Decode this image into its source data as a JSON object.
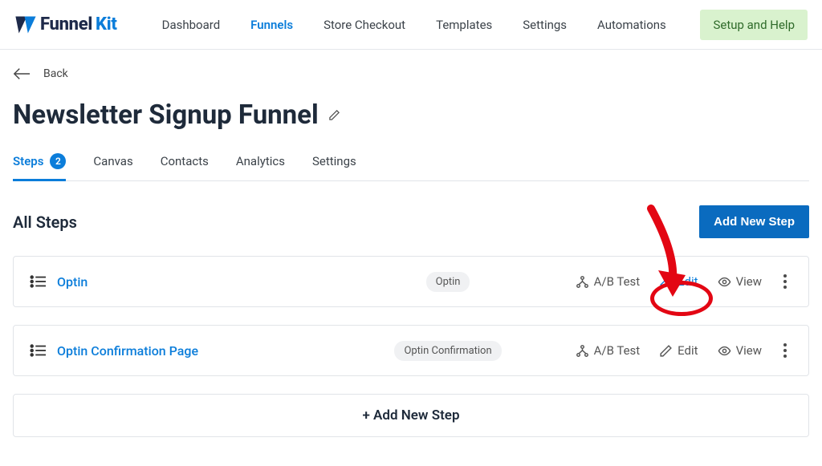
{
  "brand": {
    "name_a": "Funnel",
    "name_b": "Kit"
  },
  "nav": {
    "dashboard": "Dashboard",
    "funnels": "Funnels",
    "store_checkout": "Store Checkout",
    "templates": "Templates",
    "settings": "Settings",
    "automations": "Automations"
  },
  "setup_help": "Setup and Help",
  "back_label": "Back",
  "page_title": "Newsletter Signup Funnel",
  "tabs": {
    "steps": "Steps",
    "steps_count": "2",
    "canvas": "Canvas",
    "contacts": "Contacts",
    "analytics": "Analytics",
    "settings": "Settings"
  },
  "section_title": "All Steps",
  "add_new_step_btn": "Add New Step",
  "row1": {
    "name": "Optin",
    "pill": "Optin",
    "ab": "A/B Test",
    "edit": "Edit",
    "view": "View"
  },
  "row2": {
    "name": "Optin Confirmation Page",
    "pill": "Optin Confirmation",
    "ab": "A/B Test",
    "edit": "Edit",
    "view": "View"
  },
  "add_step_card": "+ Add New Step"
}
